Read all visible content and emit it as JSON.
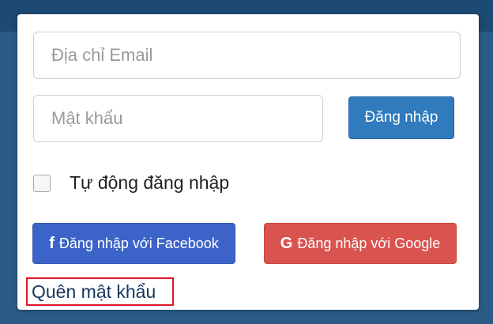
{
  "login_form": {
    "email_placeholder": "Địa chỉ Email",
    "password_placeholder": "Mật khẩu",
    "login_button": "Đăng nhập",
    "remember_label": "Tự động đăng nhập",
    "remember_checked": false,
    "facebook_icon": "f",
    "facebook_button": "Đăng nhập với Facebook",
    "google_icon": "G",
    "google_button": "Đăng nhập với Google",
    "forgot_link": "Quên mật khẩu"
  },
  "colors": {
    "background": "#2b5a85",
    "login_button": "#2f7bbd",
    "facebook": "#3c64c8",
    "google": "#d9534f",
    "link": "#17375e",
    "highlight_box": "#e0182a"
  }
}
